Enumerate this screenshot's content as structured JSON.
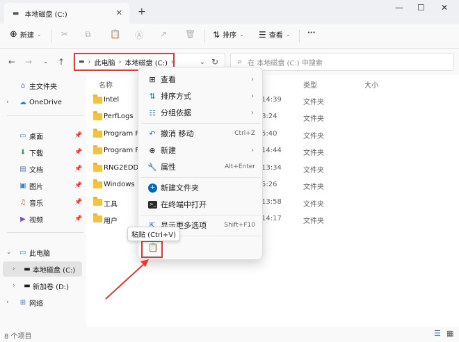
{
  "window": {
    "tab_title": "本地磁盘 (C:)",
    "close_tab": "✕",
    "new_tab": "+",
    "minimize": "—",
    "maximize": "☐",
    "close": "✕"
  },
  "toolbar": {
    "new_label": "新建",
    "sort_label": "排序",
    "view_label": "查看",
    "more_label": "···"
  },
  "address": {
    "crumbs": [
      "此电脑",
      "本地磁盘 (C:)"
    ],
    "search_placeholder": "在 本地磁盘 (C:) 中搜索"
  },
  "sidebar": {
    "items": [
      {
        "label": "主文件夹",
        "icon": "home-icon"
      },
      {
        "label": "OneDrive",
        "icon": "cloud-icon"
      },
      {
        "label": "桌面",
        "icon": "desktop-icon"
      },
      {
        "label": "下载",
        "icon": "download-icon"
      },
      {
        "label": "文档",
        "icon": "document-icon"
      },
      {
        "label": "图片",
        "icon": "picture-icon"
      },
      {
        "label": "音乐",
        "icon": "music-icon"
      },
      {
        "label": "视频",
        "icon": "video-icon"
      },
      {
        "label": "此电脑",
        "icon": "computer-icon"
      },
      {
        "label": "本地磁盘 (C:)",
        "icon": "drive-icon"
      },
      {
        "label": "新加卷 (D:)",
        "icon": "drive-icon"
      },
      {
        "label": "网络",
        "icon": "network-icon"
      }
    ]
  },
  "columns": {
    "name": "名称",
    "type": "类型",
    "size": "大小"
  },
  "files": [
    {
      "name": "Intel",
      "time": "14:39",
      "type": "文件夹"
    },
    {
      "name": "PerfLogs",
      "time": "8:24",
      "type": "文件夹"
    },
    {
      "name": "Program Fil",
      "time": "5:40",
      "type": "文件夹"
    },
    {
      "name": "Program Fil",
      "time": "14:44",
      "type": "文件夹"
    },
    {
      "name": "RNG2EDD",
      "time": "13:34",
      "type": "文件夹"
    },
    {
      "name": "Windows",
      "time": "5:26",
      "type": "文件夹"
    },
    {
      "name": "工具",
      "time": "13:58",
      "type": "文件夹"
    },
    {
      "name": "用户",
      "time": "14:17",
      "type": "文件夹"
    }
  ],
  "context_menu": {
    "view": "查看",
    "sort": "排序方式",
    "group": "分组依据",
    "undo": "撤消 移动",
    "undo_shortcut": "Ctrl+Z",
    "new": "新建",
    "properties": "属性",
    "properties_shortcut": "Alt+Enter",
    "new_folder": "新建文件夹",
    "open_terminal": "在终端中打开",
    "more_options": "显示更多选项",
    "more_options_shortcut": "Shift+F10"
  },
  "tooltip": "粘贴 (Ctrl+V)",
  "status": {
    "item_count": "8 个项目"
  },
  "colors": {
    "accent": "#0067c0",
    "highlight": "#e53935",
    "folder": "#f1c24a"
  }
}
